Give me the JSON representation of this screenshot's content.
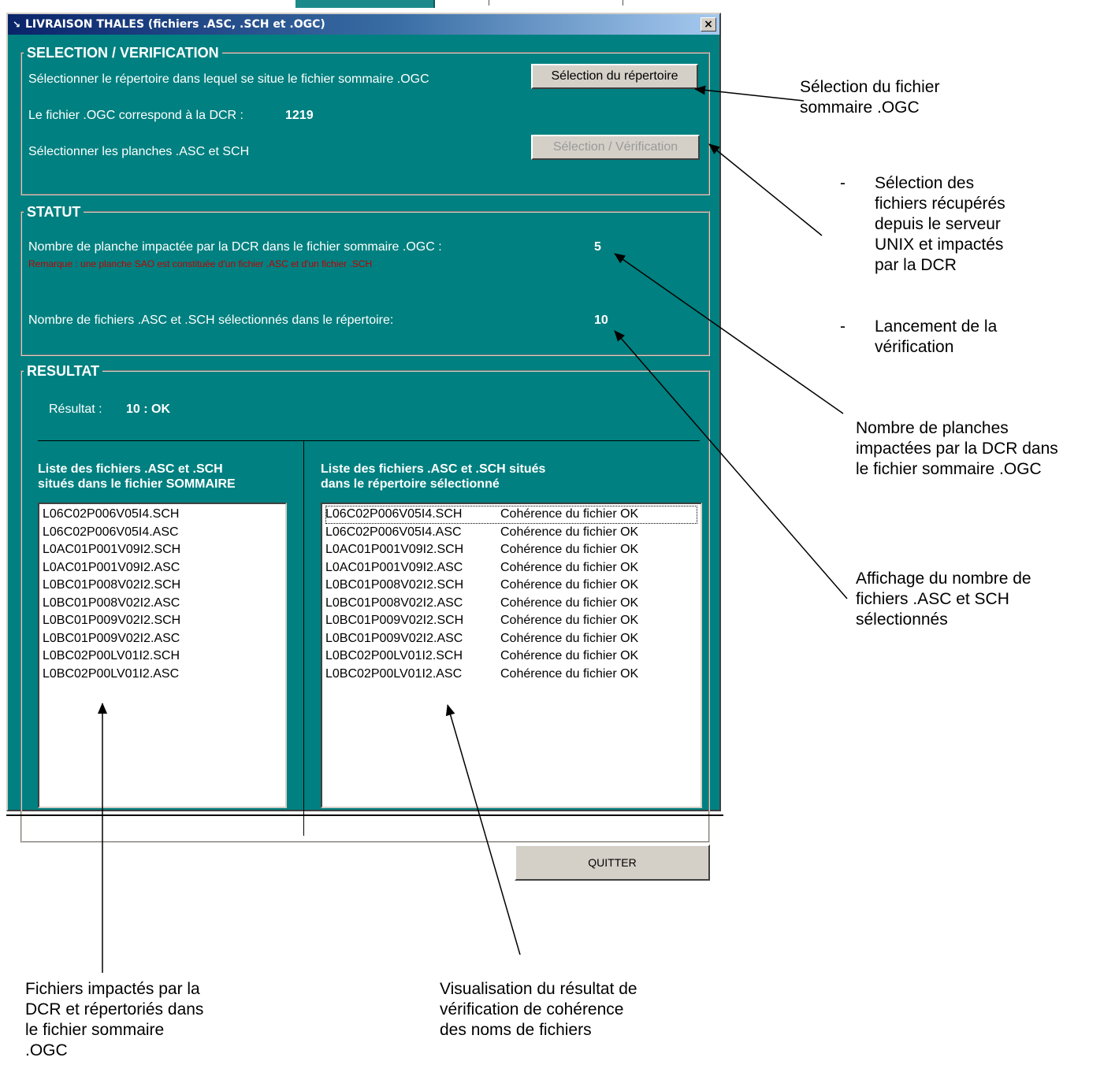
{
  "window": {
    "title": "LIVRAISON THALES (fichiers .ASC, .SCH et .OGC)",
    "close_label": "×"
  },
  "selection": {
    "legend": "SELECTION / VERIFICATION",
    "instruction_dir": "Sélectionner le répertoire dans lequel se situe le fichier sommaire .OGC",
    "button_dir": "Sélection du répertoire",
    "dcr_label": "Le fichier .OGC correspond à la DCR :",
    "dcr_value": "1219",
    "instruction_planches": "Sélectionner les planches .ASC et SCH",
    "button_verif": "Sélection / Vérification"
  },
  "statut": {
    "legend": "STATUT",
    "planches_label": "Nombre de planche impactée par la DCR dans le fichier sommaire .OGC :",
    "planches_value": "5",
    "remarque": "Remarque : une planche SAO est constituée d'un fichier .ASC et d'un fichier .SCH",
    "fichiers_label": "Nombre de fichiers .ASC et .SCH sélectionnés dans le répertoire:",
    "fichiers_value": "10"
  },
  "resultat": {
    "legend": "RESULTAT",
    "label": "Résultat :",
    "value": "10 :  OK",
    "left_header": "Liste des fichiers .ASC et .SCH\nsitués dans le fichier SOMMAIRE",
    "right_header": "Liste des fichiers .ASC et .SCH situés\ndans le répertoire sélectionné",
    "left_list": [
      "L06C02P006V05I4.SCH",
      "L06C02P006V05I4.ASC",
      "L0AC01P001V09I2.SCH",
      "L0AC01P001V09I2.ASC",
      "L0BC01P008V02I2.SCH",
      "L0BC01P008V02I2.ASC",
      "L0BC01P009V02I2.SCH",
      "L0BC01P009V02I2.ASC",
      "L0BC02P00LV01I2.SCH",
      "L0BC02P00LV01I2.ASC"
    ],
    "right_list": [
      {
        "file": "L06C02P006V05I4.SCH",
        "status": "Cohérence du fichier OK"
      },
      {
        "file": "L06C02P006V05I4.ASC",
        "status": "Cohérence du fichier OK"
      },
      {
        "file": "L0AC01P001V09I2.SCH",
        "status": "Cohérence du fichier OK"
      },
      {
        "file": "L0AC01P001V09I2.ASC",
        "status": "Cohérence du fichier OK"
      },
      {
        "file": "L0BC01P008V02I2.SCH",
        "status": "Cohérence du fichier OK"
      },
      {
        "file": "L0BC01P008V02I2.ASC",
        "status": "Cohérence du fichier OK"
      },
      {
        "file": "L0BC01P009V02I2.SCH",
        "status": "Cohérence du fichier OK"
      },
      {
        "file": "L0BC01P009V02I2.ASC",
        "status": "Cohérence du fichier OK"
      },
      {
        "file": "L0BC02P00LV01I2.SCH",
        "status": "Cohérence du fichier OK"
      },
      {
        "file": "L0BC02P00LV01I2.ASC",
        "status": "Cohérence du fichier OK"
      }
    ]
  },
  "quit_label": "QUITTER",
  "annotations": {
    "selection_fichier": "Sélection du fichier\nsommaire .OGC",
    "bullet": "-",
    "selection_fichiers": "Sélection des\nfichiers récupérés\ndepuis le serveur\nUNIX et impactés\npar la DCR",
    "lancement": "Lancement de la\nvérification",
    "nombre_planches": "Nombre de planches\nimpactées par la DCR dans\nle fichier sommaire .OGC",
    "affichage": "Affichage du nombre de\nfichiers .ASC et SCH\nsélectionnés",
    "fichiers_impactes": "Fichiers impactés par la\nDCR et répertoriés dans\nle fichier sommaire\n.OGC",
    "visualisation": "Visualisation du résultat de\nvérification de cohérence\ndes noms de fichiers"
  }
}
